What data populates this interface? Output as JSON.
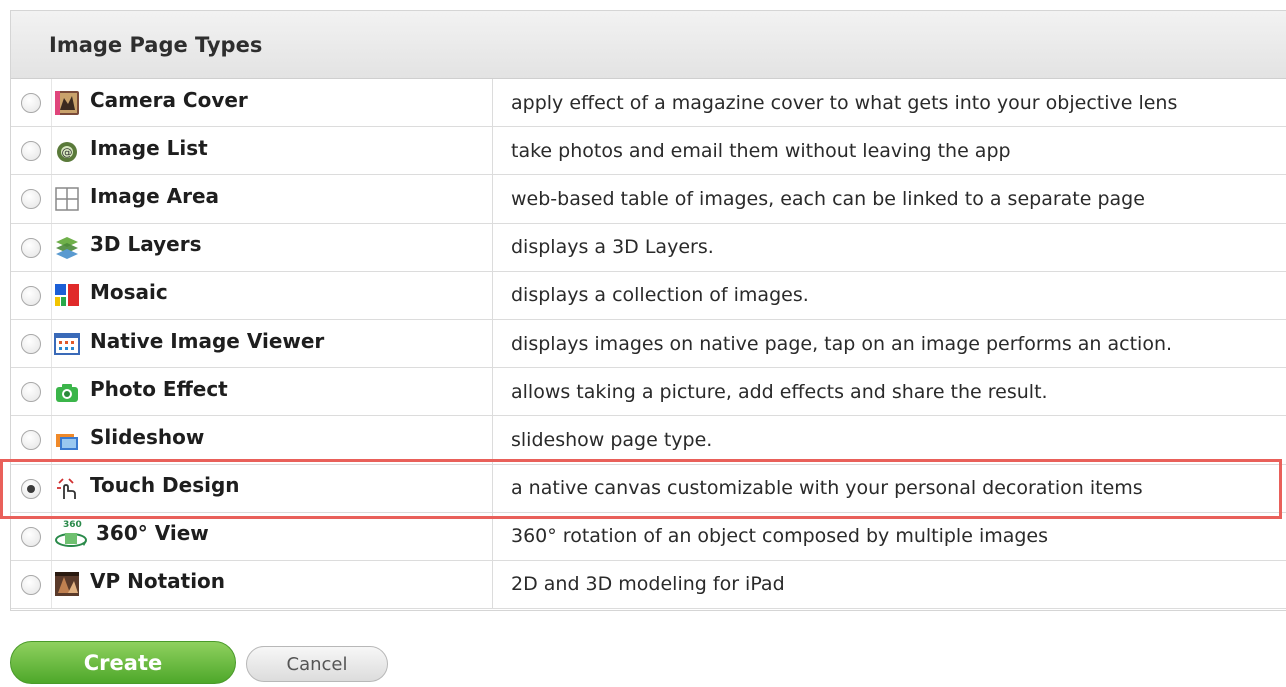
{
  "panel": {
    "title": "Image Page Types"
  },
  "rows": [
    {
      "name": "Camera Cover",
      "description": "apply effect of a magazine cover to what gets into your objective lens",
      "icon": "camera-cover-icon",
      "selected": false
    },
    {
      "name": "Image List",
      "description": "take photos and email them without leaving the app",
      "icon": "image-list-icon",
      "selected": false
    },
    {
      "name": "Image Area",
      "description": "web-based table of images, each can be linked to a separate page",
      "icon": "grid-icon",
      "selected": false
    },
    {
      "name": "3D Layers",
      "description": "displays a 3D Layers.",
      "icon": "layers-icon",
      "selected": false
    },
    {
      "name": "Mosaic",
      "description": "displays a collection of images.",
      "icon": "mosaic-icon",
      "selected": false
    },
    {
      "name": "Native Image Viewer",
      "description": "displays images on native page, tap on an image performs an action.",
      "icon": "image-viewer-icon",
      "selected": false
    },
    {
      "name": "Photo Effect",
      "description": "allows taking a picture, add effects and share the result.",
      "icon": "camera-icon",
      "selected": false
    },
    {
      "name": "Slideshow",
      "description": "slideshow page type.",
      "icon": "slideshow-icon",
      "selected": false
    },
    {
      "name": "Touch Design",
      "description": "a native canvas customizable with your personal decoration items",
      "icon": "touch-gesture-icon",
      "selected": true
    },
    {
      "name": "360° View",
      "description": "360° rotation of an object composed by multiple images",
      "icon": "rotate-360-icon",
      "icon_text": "360",
      "selected": false
    },
    {
      "name": "VP Notation",
      "description": "2D and 3D modeling for iPad",
      "icon": "vp-notation-icon",
      "selected": false
    }
  ],
  "buttons": {
    "create_label": "Create",
    "cancel_label": "Cancel"
  },
  "colors": {
    "highlight": "#e9605a",
    "create_button": "#5cb335"
  }
}
